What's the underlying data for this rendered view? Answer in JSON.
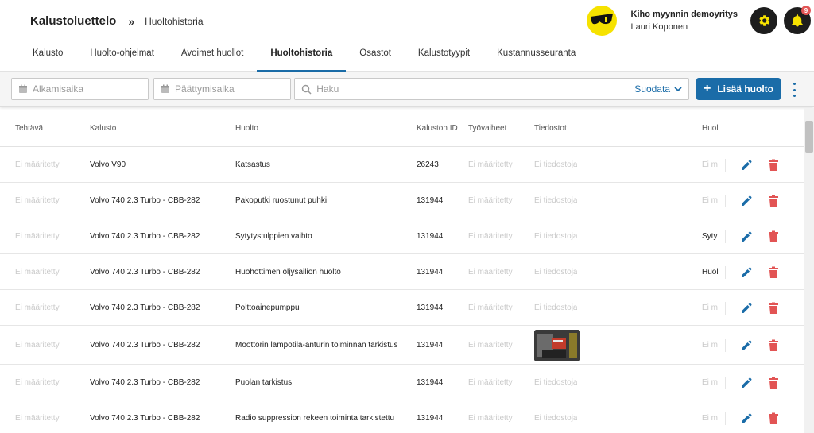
{
  "breadcrumb": {
    "root": "Kalustoluettelo",
    "separator": "»",
    "current": "Huoltohistoria"
  },
  "account": {
    "company": "Kiho myynnin demoyritys",
    "user": "Lauri Koponen",
    "notification_count": "9"
  },
  "tabs": [
    {
      "label": "Kalusto",
      "active": false
    },
    {
      "label": "Huolto-ohjelmat",
      "active": false
    },
    {
      "label": "Avoimet huollot",
      "active": false
    },
    {
      "label": "Huoltohistoria",
      "active": true
    },
    {
      "label": "Osastot",
      "active": false
    },
    {
      "label": "Kalustotyypit",
      "active": false
    },
    {
      "label": "Kustannusseuranta",
      "active": false
    }
  ],
  "toolbar": {
    "start_placeholder": "Alkamisaika",
    "end_placeholder": "Päättymisaika",
    "search_placeholder": "Haku",
    "filter_label": "Suodata",
    "add_label": "Lisää huolto"
  },
  "colors": {
    "accent": "#1a6ca8",
    "danger": "#e25454",
    "logo": "#f6e200"
  },
  "table": {
    "headers": [
      "Tehtävä",
      "Kalusto",
      "Huolto",
      "Kaluston ID",
      "Työvaiheet",
      "Tiedostot",
      "Huol"
    ],
    "rows": [
      {
        "tehtava": "Ei määritetty",
        "kalusto": "Volvo V90",
        "huolto": "Katsastus",
        "id": "26243",
        "tyovaiheet": "Ei määritetty",
        "tiedostot": "Ei tiedostoja",
        "huol": "Ei m",
        "huol_dark": false,
        "image": false
      },
      {
        "tehtava": "Ei määritetty",
        "kalusto": "Volvo 740 2.3 Turbo - CBB-282",
        "huolto": "Pakoputki ruostunut puhki",
        "id": "131944",
        "tyovaiheet": "Ei määritetty",
        "tiedostot": "Ei tiedostoja",
        "huol": "Ei m",
        "huol_dark": false,
        "image": false
      },
      {
        "tehtava": "Ei määritetty",
        "kalusto": "Volvo 740 2.3 Turbo - CBB-282",
        "huolto": "Sytytystulppien vaihto",
        "id": "131944",
        "tyovaiheet": "Ei määritetty",
        "tiedostot": "Ei tiedostoja",
        "huol": "Syty",
        "huol_dark": true,
        "image": false
      },
      {
        "tehtava": "Ei määritetty",
        "kalusto": "Volvo 740 2.3 Turbo - CBB-282",
        "huolto": "Huohottimen öljysäiliön huolto",
        "id": "131944",
        "tyovaiheet": "Ei määritetty",
        "tiedostot": "Ei tiedostoja",
        "huol": "Huol",
        "huol_dark": true,
        "image": false
      },
      {
        "tehtava": "Ei määritetty",
        "kalusto": "Volvo 740 2.3 Turbo - CBB-282",
        "huolto": "Polttoainepumppu",
        "id": "131944",
        "tyovaiheet": "Ei määritetty",
        "tiedostot": "Ei tiedostoja",
        "huol": "Ei m",
        "huol_dark": false,
        "image": false
      },
      {
        "tehtava": "Ei määritetty",
        "kalusto": "Volvo 740 2.3 Turbo - CBB-282",
        "huolto": "Moottorin lämpötila-anturin toiminnan tarkistus",
        "id": "131944",
        "tyovaiheet": "Ei määritetty",
        "tiedostot": "",
        "huol": "Ei m",
        "huol_dark": false,
        "image": true
      },
      {
        "tehtava": "Ei määritetty",
        "kalusto": "Volvo 740 2.3 Turbo - CBB-282",
        "huolto": "Puolan tarkistus",
        "id": "131944",
        "tyovaiheet": "Ei määritetty",
        "tiedostot": "Ei tiedostoja",
        "huol": "Ei m",
        "huol_dark": false,
        "image": false
      },
      {
        "tehtava": "Ei määritetty",
        "kalusto": "Volvo 740 2.3 Turbo - CBB-282",
        "huolto": "Radio suppression rekeen toiminta tarkistettu",
        "id": "131944",
        "tyovaiheet": "Ei määritetty",
        "tiedostot": "Ei tiedostoja",
        "huol": "Ei m",
        "huol_dark": false,
        "image": false
      }
    ]
  }
}
